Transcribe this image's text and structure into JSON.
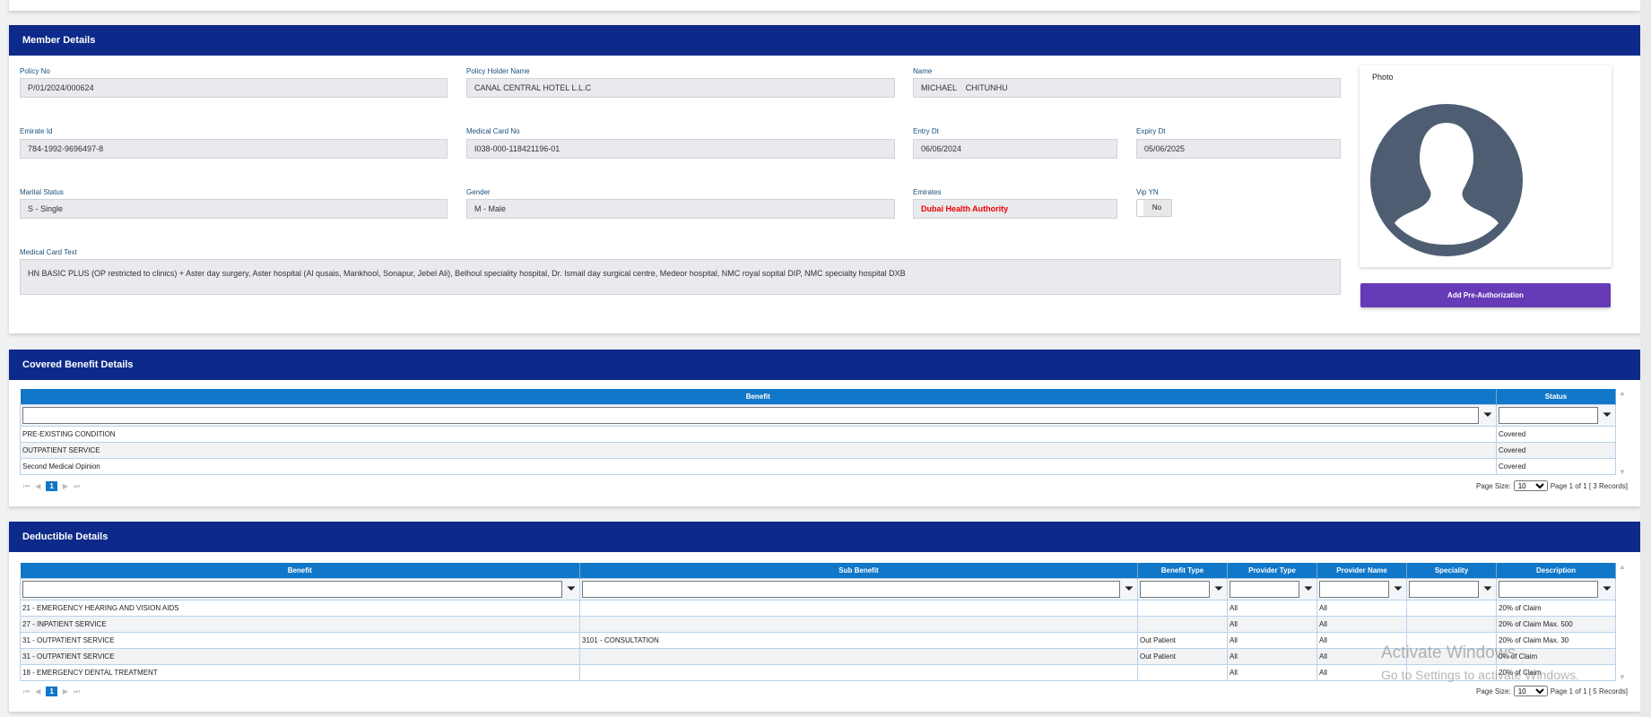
{
  "member": {
    "title": "Member Details",
    "policy_no": {
      "label": "Policy No",
      "value": "P/01/2024/000624"
    },
    "holder": {
      "label": "Policy Holder Name",
      "value": "CANAL CENTRAL HOTEL L.L.C"
    },
    "name": {
      "label": "Name",
      "value": "MICHAEL    CHITUNHU"
    },
    "emirate_id": {
      "label": "Emirate Id",
      "value": "784-1992-9696497-8"
    },
    "card_no": {
      "label": "Medical Card No",
      "value": "I038-000-118421196-01"
    },
    "entry": {
      "label": "Entry Dt",
      "value": "06/06/2024"
    },
    "expiry": {
      "label": "Expiry Dt",
      "value": "05/06/2025"
    },
    "marital": {
      "label": "Marital Status",
      "value": "S - Single"
    },
    "gender": {
      "label": "Gender",
      "value": "M - Male"
    },
    "emirates": {
      "label": "Emirates",
      "value": "Dubai Health Authority"
    },
    "vip": {
      "label": "Vip YN",
      "value": "No"
    },
    "card_text": {
      "label": "Medical Card Text",
      "value": "HN BASIC PLUS (OP restricted to clinics) + Aster day surgery, Aster hospital (Al qusais, Mankhool, Sonapur, Jebel Ali), Belhoul speciality hospital, Dr. Ismail day surgical centre, Medeor hospital, NMC royal sopital DIP,  NMC specialty hospital DXB"
    },
    "photo_label": "Photo",
    "add_button": "Add Pre-Authorization"
  },
  "covered": {
    "title": "Covered Benefit Details",
    "columns": [
      "Benefit",
      "Status"
    ],
    "rows": [
      [
        "PRE-EXISTING CONDITION",
        "Covered"
      ],
      [
        "OUTPATIENT SERVICE",
        "Covered"
      ],
      [
        "Second Medical Opinion",
        "Covered"
      ]
    ],
    "page": "1",
    "page_size_label": "Page Size:",
    "page_size": "10",
    "page_info": "Page 1 of 1 [ 3 Records]"
  },
  "deductible": {
    "title": "Deductible Details",
    "columns": [
      "Benefit",
      "Sub Benefit",
      "Benefit Type",
      "Provider Type",
      "Provider Name",
      "Speciality",
      "Description"
    ],
    "rows": [
      [
        "21 - EMERGENCY HEARING AND VISION AIDS",
        "",
        "",
        "All",
        "All",
        "",
        "20% of Claim"
      ],
      [
        "27 - INPATIENT SERVICE",
        "",
        "",
        "All",
        "All",
        "",
        "20% of Claim Max. 500"
      ],
      [
        "31 - OUTPATIENT SERVICE",
        "3101 - CONSULTATION",
        "Out Patient",
        "All",
        "All",
        "",
        "20% of Claim Max. 30"
      ],
      [
        "31 - OUTPATIENT SERVICE",
        "",
        "Out Patient",
        "All",
        "All",
        "",
        "0% of Claim"
      ],
      [
        "18 - EMERGENCY DENTAL TREATMENT",
        "",
        "",
        "All",
        "All",
        "",
        "20% of Claim"
      ]
    ],
    "page": "1",
    "page_size_label": "Page Size:",
    "page_size": "10",
    "page_info": "Page 1 of 1 [ 5 Records]"
  },
  "watermark": {
    "line1": "Activate Windows",
    "line2": "Go to Settings to activate Windows."
  }
}
